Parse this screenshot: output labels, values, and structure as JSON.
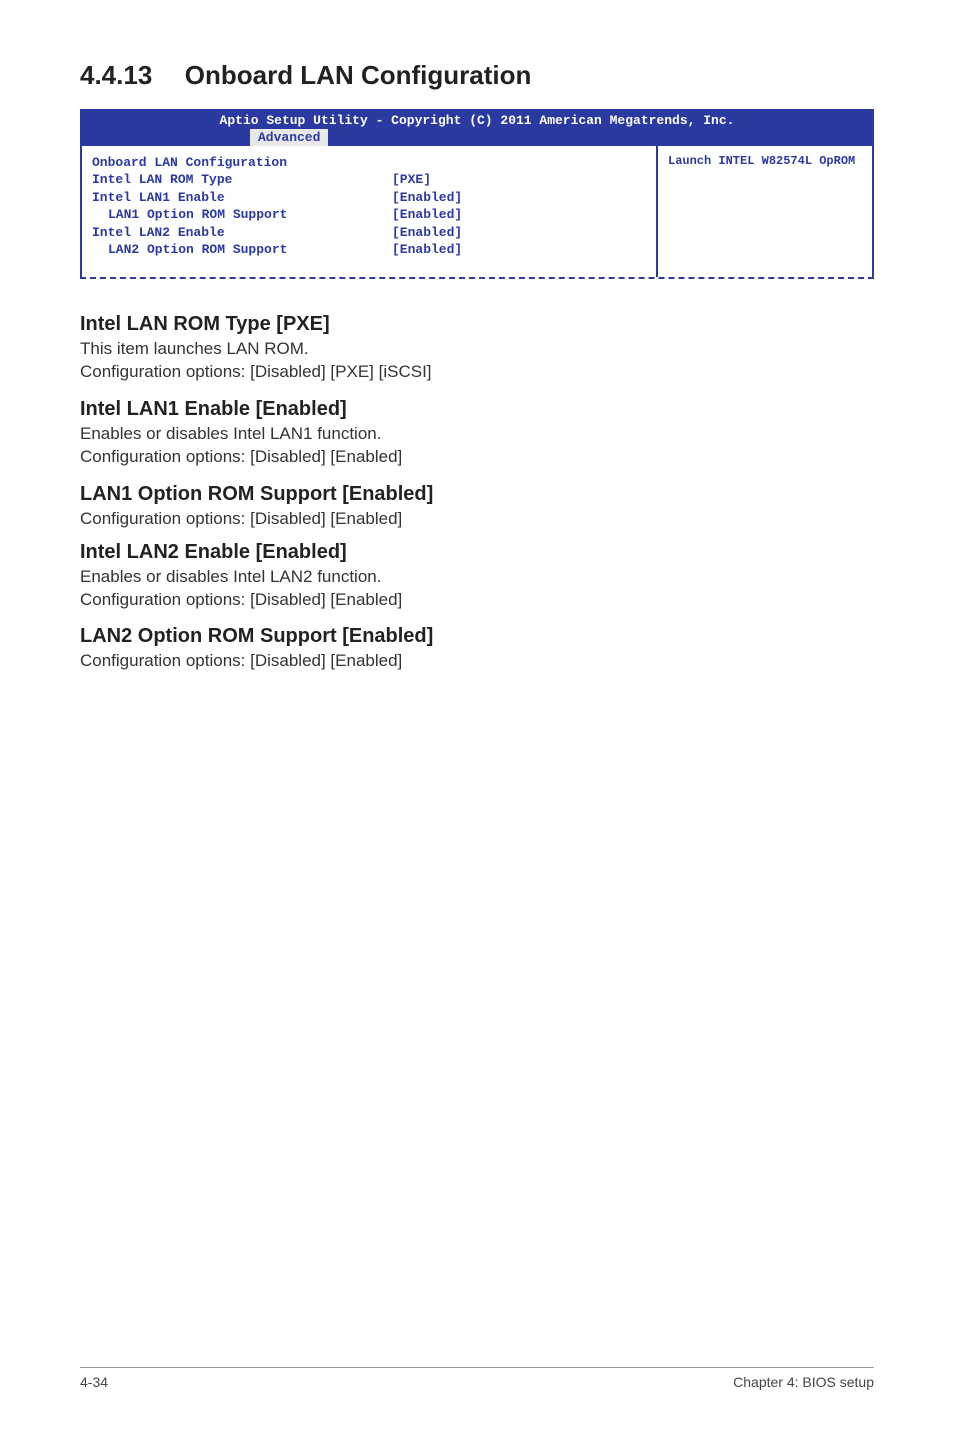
{
  "header": {
    "section_number": "4.4.13",
    "section_title": "Onboard LAN Configuration"
  },
  "bios": {
    "titlebar": "Aptio Setup Utility - Copyright (C) 2011 American Megatrends, Inc.",
    "tab": "Advanced",
    "help": "Launch INTEL W82574L OpROM",
    "rows": [
      {
        "label": "Onboard LAN Configuration",
        "value": ""
      },
      {
        "label": "Intel LAN ROM Type",
        "value": "[PXE]"
      },
      {
        "label": "Intel LAN1 Enable",
        "value": "[Enabled]"
      },
      {
        "label": "LAN1 Option ROM Support",
        "value": "[Enabled]",
        "indent": true
      },
      {
        "label": "Intel LAN2 Enable",
        "value": "[Enabled]"
      },
      {
        "label": "LAN2 Option ROM Support",
        "value": "[Enabled]",
        "indent": true
      }
    ]
  },
  "sections": [
    {
      "title": "Intel LAN ROM Type [PXE]",
      "lines": [
        "This item launches LAN ROM.",
        "Configuration options: [Disabled] [PXE] [iSCSI]"
      ]
    },
    {
      "title": "Intel LAN1 Enable [Enabled]",
      "lines": [
        "Enables or disables Intel LAN1 function.",
        "Configuration options: [Disabled] [Enabled]"
      ]
    },
    {
      "title": "LAN1 Option ROM Support [Enabled]",
      "lines": [
        "Configuration options: [Disabled] [Enabled]"
      ]
    },
    {
      "title": "Intel LAN2 Enable [Enabled]",
      "lines": [
        "Enables or disables Intel LAN2 function.",
        "Configuration options: [Disabled] [Enabled]"
      ]
    },
    {
      "title": "LAN2 Option ROM Support [Enabled]",
      "lines": [
        "Configuration options: [Disabled] [Enabled]"
      ]
    }
  ],
  "footer": {
    "left": "4-34",
    "right": "Chapter 4: BIOS setup"
  }
}
